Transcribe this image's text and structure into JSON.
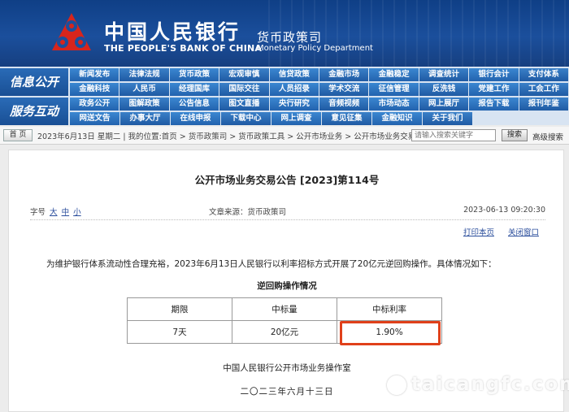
{
  "header": {
    "bank_name_cn": "中国人民银行",
    "bank_name_en": "THE PEOPLE'S BANK OF CHINA",
    "dept_cn": "货币政策司",
    "dept_en": "Monetary Policy Department",
    "bg_color": "#1b4f9c"
  },
  "nav": {
    "band1": "信息公开",
    "band2": "服务互动",
    "rows": [
      [
        "新闻发布",
        "法律法规",
        "货币政策",
        "宏观审慎",
        "信贷政策",
        "金融市场",
        "金融稳定",
        "调查统计",
        "银行会计",
        "支付体系"
      ],
      [
        "金融科技",
        "人民币",
        "经理国库",
        "国际交往",
        "人员招录",
        "学术交流",
        "征信管理",
        "反洗钱",
        "党建工作",
        "工会工作"
      ],
      [
        "政务公开",
        "图解政策",
        "公告信息",
        "图文直播",
        "央行研究",
        "音频视频",
        "市场动态",
        "网上展厅",
        "报告下载",
        "报刊年鉴"
      ],
      [
        "网送文告",
        "办事大厅",
        "在线申报",
        "下载中心",
        "网上调查",
        "意见征集",
        "金融知识",
        "关于我们"
      ]
    ]
  },
  "breadcrumb": {
    "home_label": "首 页",
    "text": "2023年6月13日 星期二 | 我的位置:首页 > 货币政策司 > 货币政策工具 > 公开市场业务 > 公开市场业务交易公告",
    "search_placeholder": "请输入搜索关键字",
    "search_button": "搜索",
    "advanced_search": "高级搜索"
  },
  "article": {
    "title": "公开市场业务交易公告 [2023]第114号",
    "font_size_label": "字号",
    "font_sizes": [
      "大",
      "中",
      "小"
    ],
    "source": "文章来源：货币政策司",
    "date": "2023-06-13 09:20:30",
    "print_label": "打印本页",
    "close_label": "关闭窗口",
    "paragraph": "为维护银行体系流动性合理充裕，2023年6月13日人民银行以利率招标方式开展了20亿元逆回购操作。具体情况如下：",
    "table_title": "逆回购操作情况",
    "table": {
      "headers": [
        "期限",
        "中标量",
        "中标利率"
      ],
      "rows": [
        [
          "7天",
          "20亿元",
          "1.90%"
        ]
      ]
    },
    "signoff": "中国人民银行公开市场业务操作室",
    "sign_date": "二〇二三年六月十三日"
  },
  "watermark": "taicangfc.com",
  "highlight_color": "#e0401a"
}
